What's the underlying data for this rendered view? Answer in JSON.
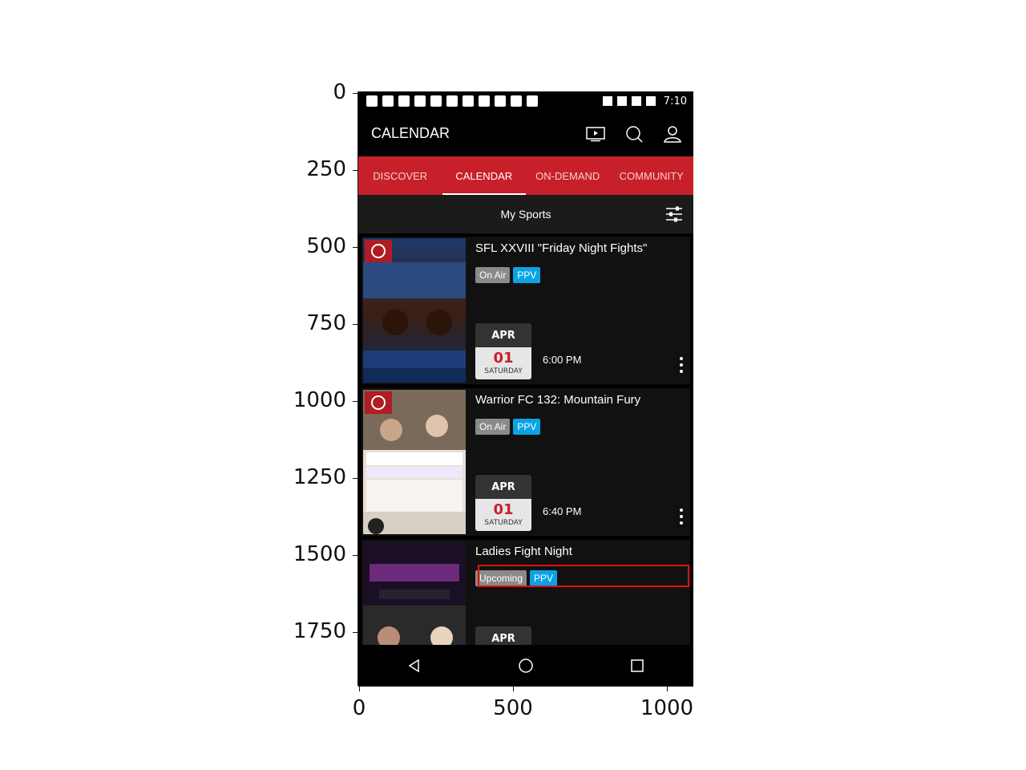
{
  "plot_axes": {
    "y_ticks": [
      "0",
      "250",
      "500",
      "750",
      "1000",
      "1250",
      "1500",
      "1750"
    ],
    "x_ticks": [
      "0",
      "500",
      "1000"
    ]
  },
  "status_bar": {
    "time": "7:10"
  },
  "app_bar": {
    "title": "CALENDAR",
    "icons": [
      "tv-icon",
      "search-icon",
      "account-icon"
    ]
  },
  "tabs": [
    {
      "label": "DISCOVER",
      "active": false
    },
    {
      "label": "CALENDAR",
      "active": true
    },
    {
      "label": "ON-DEMAND",
      "active": false
    },
    {
      "label": "COMMUNITY",
      "active": false
    }
  ],
  "filter": {
    "label": "My Sports"
  },
  "events": [
    {
      "title": "SFL XXVIII \"Friday Night Fights\"",
      "status_badge": "On Air",
      "type_badge": "PPV",
      "month": "APR",
      "day": "01",
      "weekday": "SATURDAY",
      "time": "6:00 PM",
      "poster_colors": [
        "#1c3a6e",
        "#3b1f12"
      ]
    },
    {
      "title": "Warrior FC 132: Mountain Fury",
      "status_badge": "On Air",
      "type_badge": "PPV",
      "month": "APR",
      "day": "01",
      "weekday": "SATURDAY",
      "time": "6:40 PM",
      "poster_colors": [
        "#7a6a5a",
        "#c9b9a8"
      ]
    },
    {
      "title": "Ladies Fight Night",
      "status_badge": "Upcoming",
      "type_badge": "PPV",
      "month": "APR",
      "poster_colors": [
        "#1a0f24",
        "#6b2a7a"
      ]
    }
  ],
  "colors": {
    "accent": "#c8202a",
    "ppv": "#0aa3e6",
    "highlight": "#e01010"
  }
}
